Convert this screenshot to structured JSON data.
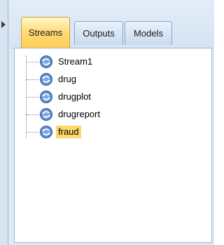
{
  "tabs": [
    {
      "label": "Streams",
      "active": true
    },
    {
      "label": "Outputs",
      "active": false
    },
    {
      "label": "Models",
      "active": false
    }
  ],
  "streams": [
    {
      "label": "Stream1",
      "icon": "stream-icon"
    },
    {
      "label": "drug",
      "icon": "stream-icon"
    },
    {
      "label": "drugplot",
      "icon": "stream-icon"
    },
    {
      "label": "drugreport",
      "icon": "stream-icon"
    },
    {
      "label": "fraud",
      "icon": "stream-icon",
      "selected": true
    }
  ],
  "colors": {
    "active_tab": "#ffd870",
    "selection": "#ffd86b",
    "icon_blue": "#4f7fc4"
  }
}
